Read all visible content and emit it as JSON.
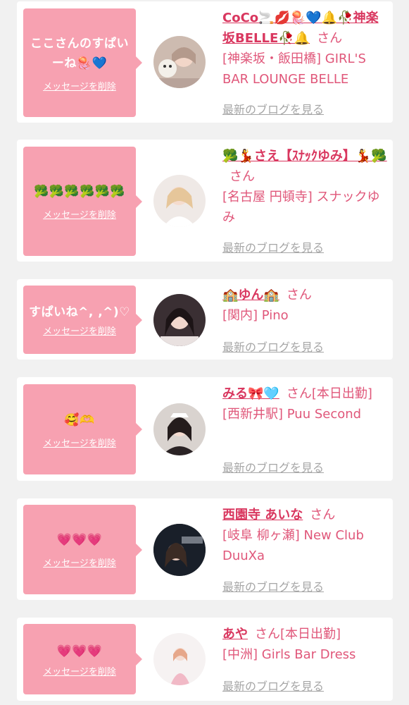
{
  "delete_label": "メッセージを削除",
  "san_label": "さん",
  "blog_label": "最新のブログを見る",
  "cards": [
    {
      "message": "ここさんのすぱいーね🪼💙",
      "name": "CoCo🚬💋🪼💙🔔🥀神楽坂BELLE🥀🔔",
      "suffix": "",
      "shop": "[神楽坂・飯田橋] GIRL'S BAR LOUNGE BELLE"
    },
    {
      "message": "🥦🥦🥦🥦🥦🥦",
      "name": "🥦💃さえ【ｽﾅｯｸゆみ】💃🥦",
      "suffix": "",
      "shop": "[名古屋 円頓寺] スナックゆみ"
    },
    {
      "message": "すぱいね^, ,^)♡",
      "name": "🏫ゆん🏫",
      "suffix": "",
      "shop": "[関内] Pino"
    },
    {
      "message": "🥰🫶",
      "name": "みる🎀🩵",
      "suffix": "[本日出勤]",
      "shop": "[西新井駅] Puu Second"
    },
    {
      "message": "💗💗💗",
      "name": "西園寺 あいな",
      "suffix": "",
      "shop": "[岐阜 柳ヶ瀬] New Club DuuXa"
    },
    {
      "message": "💗💗💗",
      "name": "あや",
      "suffix": "[本日出勤]",
      "shop": "[中洲] Girls Bar Dress"
    }
  ]
}
